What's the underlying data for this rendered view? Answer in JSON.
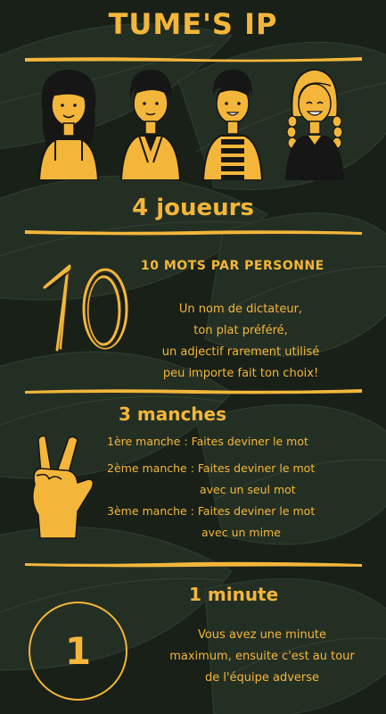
{
  "title": "TUME'S IP",
  "players_heading": "4 joueurs",
  "words": {
    "number": "10",
    "heading": "10 MOTS PAR PERSONNE",
    "lines": [
      "Un nom de dictateur,",
      "ton plat préféré,",
      "un adjectif rarement utilisé",
      "peu importe fait ton choix!"
    ]
  },
  "rounds": {
    "heading": "3 manches",
    "lines": [
      "1ère manche : Faites deviner le mot",
      "2ème manche : Faites deviner le mot",
      "avec un seul mot",
      "3ème manche : Faites deviner le mot",
      "avec un mime"
    ]
  },
  "minute": {
    "heading": "1 minute",
    "number": "1",
    "lines": [
      "Vous avez une minute",
      "maximum, ensuite c'est au tour",
      "de l'équipe adverse"
    ]
  },
  "colors": {
    "accent": "#f4b63a",
    "background": "#1f271f",
    "outline": "#161616"
  },
  "icons": [
    "player-avatar-icon",
    "ten-number-icon",
    "peace-hand-icon",
    "timer-circle-icon"
  ]
}
